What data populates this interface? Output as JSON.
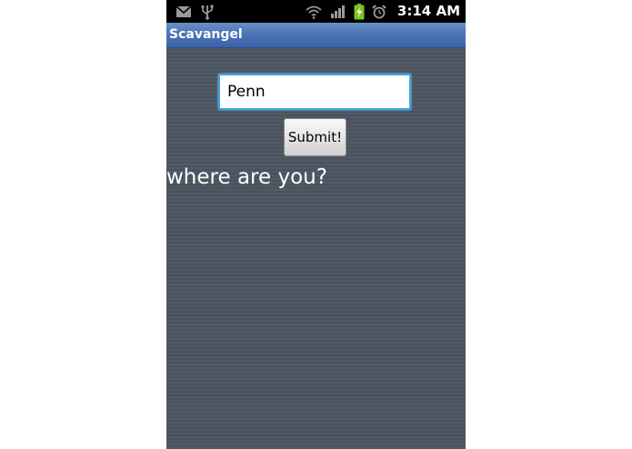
{
  "status_bar": {
    "time": "3:14 AM",
    "icons": [
      "mail-icon",
      "usb-icon",
      "wifi-icon",
      "signal-icon",
      "battery-icon",
      "alarm-icon"
    ]
  },
  "app": {
    "title": "Scavangel"
  },
  "form": {
    "input_value": "Penn",
    "submit_label": "Submit!",
    "prompt": "where are you?"
  },
  "colors": {
    "background": "#4c5561",
    "title_bar": "#4a72b4",
    "input_focus": "#3aa5e4",
    "battery": "#7cc520"
  }
}
